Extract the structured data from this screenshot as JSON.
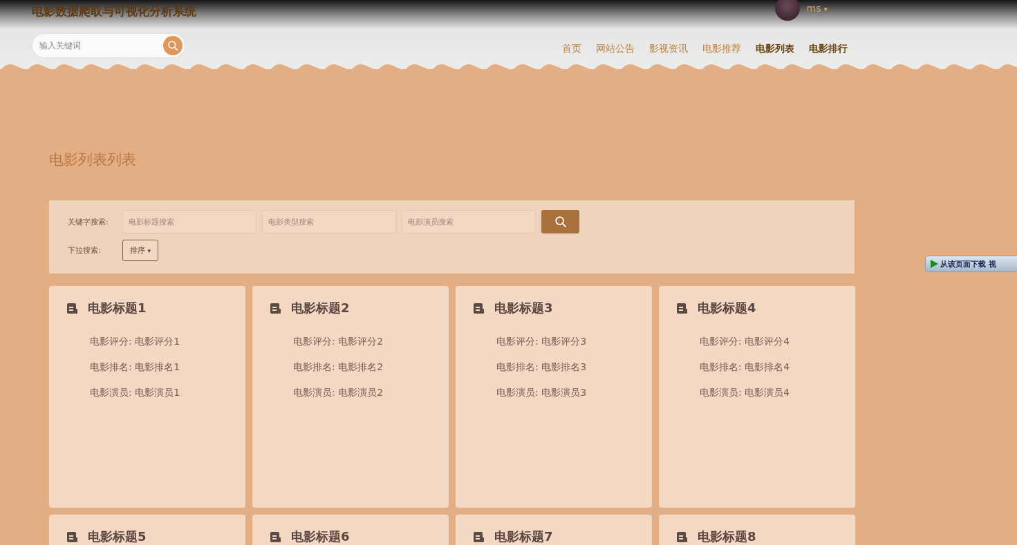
{
  "header": {
    "site_title": "电影数据爬取与可视化分析系统",
    "user": {
      "name": "ms",
      "caret": "▾"
    },
    "search": {
      "placeholder": "输入关键词"
    },
    "nav": [
      {
        "label": "首页",
        "selected": false
      },
      {
        "label": "网站公告",
        "selected": false
      },
      {
        "label": "影视资讯",
        "selected": false
      },
      {
        "label": "电影推荐",
        "selected": false
      },
      {
        "label": "电影列表",
        "selected": true
      },
      {
        "label": "电影排行",
        "selected": true
      }
    ]
  },
  "page_title": "电影列表列表",
  "filters": {
    "keyword_label": "关键字搜索:",
    "fields": [
      {
        "placeholder": "电影标题搜索"
      },
      {
        "placeholder": "电影类型搜索"
      },
      {
        "placeholder": "电影演员搜索"
      }
    ],
    "dropdown_label": "下拉搜索:",
    "dropdown": {
      "label": "排序",
      "caret": "▾"
    }
  },
  "cards": [
    {
      "title": "电影标题1",
      "fields": [
        {
          "label": "电影评分:",
          "value": "电影评分1"
        },
        {
          "label": "电影排名:",
          "value": "电影排名1"
        },
        {
          "label": "电影演员:",
          "value": "电影演员1"
        }
      ]
    },
    {
      "title": "电影标题2",
      "fields": [
        {
          "label": "电影评分:",
          "value": "电影评分2"
        },
        {
          "label": "电影排名:",
          "value": "电影排名2"
        },
        {
          "label": "电影演员:",
          "value": "电影演员2"
        }
      ]
    },
    {
      "title": "电影标题3",
      "fields": [
        {
          "label": "电影评分:",
          "value": "电影评分3"
        },
        {
          "label": "电影排名:",
          "value": "电影排名3"
        },
        {
          "label": "电影演员:",
          "value": "电影演员3"
        }
      ]
    },
    {
      "title": "电影标题4",
      "fields": [
        {
          "label": "电影评分:",
          "value": "电影评分4"
        },
        {
          "label": "电影排名:",
          "value": "电影排名4"
        },
        {
          "label": "电影演员:",
          "value": "电影演员4"
        }
      ]
    },
    {
      "title": "电影标题5"
    },
    {
      "title": "电影标题6"
    },
    {
      "title": "电影标题7"
    },
    {
      "title": "电影标题8"
    }
  ],
  "download_overlay": {
    "label": "从该页面下载 视"
  }
}
